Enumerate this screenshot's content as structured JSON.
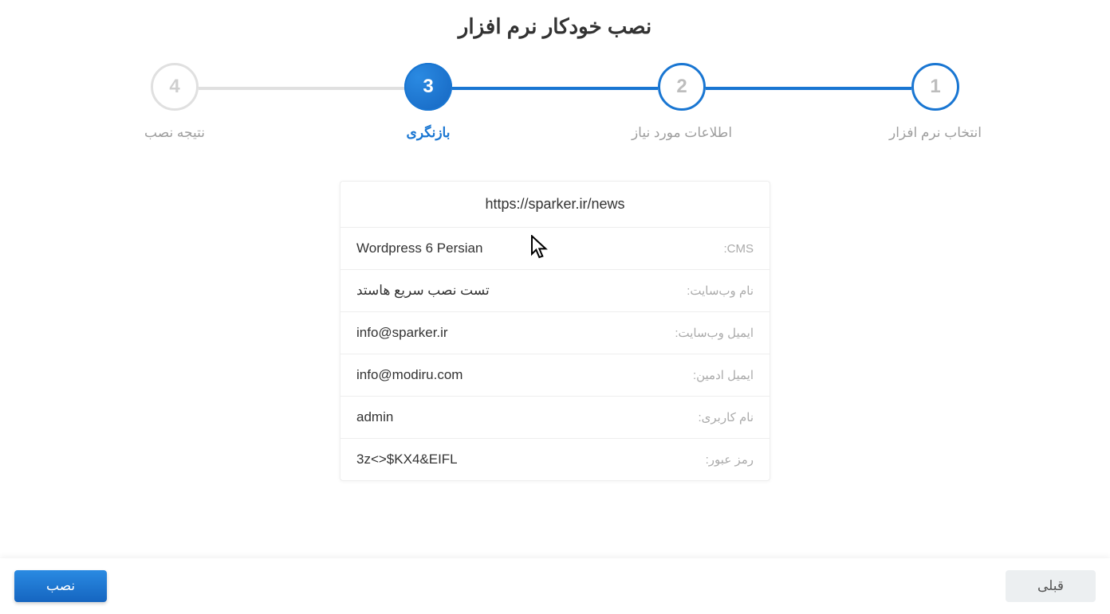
{
  "title": "نصب خودکار نرم افزار",
  "steps": [
    {
      "num": "1",
      "label": "انتخاب نرم افزار",
      "state": "done"
    },
    {
      "num": "2",
      "label": "اطلاعات مورد نیاز",
      "state": "done"
    },
    {
      "num": "3",
      "label": "بازنگری",
      "state": "active"
    },
    {
      "num": "4",
      "label": "نتیجه نصب",
      "state": "upcoming"
    }
  ],
  "review": {
    "url": "https://sparker.ir/news",
    "rows": [
      {
        "label": "CMS:",
        "value": "Wordpress 6 Persian",
        "rtl": false
      },
      {
        "label": "نام وب‌سایت:",
        "value": "تست نصب سریع هاستد",
        "rtl": true
      },
      {
        "label": "ایمیل وب‌سایت:",
        "value": "info@sparker.ir",
        "rtl": false
      },
      {
        "label": "ایمیل ادمین:",
        "value": "info@modiru.com",
        "rtl": false
      },
      {
        "label": "نام کاربری:",
        "value": "admin",
        "rtl": false
      },
      {
        "label": "رمز عبور:",
        "value": "3z<>$KX4&EIFL",
        "rtl": false
      }
    ]
  },
  "buttons": {
    "prev": "قبلی",
    "install": "نصب"
  }
}
